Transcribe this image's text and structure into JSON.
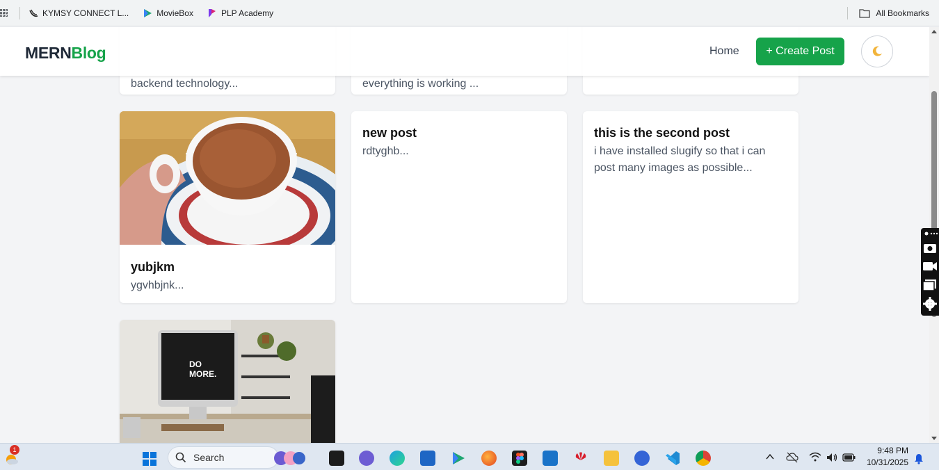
{
  "bookmarks": {
    "items": [
      {
        "label": "KYMSY CONNECT L...",
        "icon": "kymsy-icon"
      },
      {
        "label": "MovieBox",
        "icon": "moviebox-icon"
      },
      {
        "label": "PLP Academy",
        "icon": "plp-icon"
      }
    ],
    "all_label": "All Bookmarks"
  },
  "navbar": {
    "logo_part1": "MERN",
    "logo_part2": "Blog",
    "home_label": "Home",
    "create_label": "+ Create Post",
    "theme_icon": "moon-icon"
  },
  "top_row": [
    {
      "excerpt": "backend technology..."
    },
    {
      "excerpt": "everything is working ..."
    },
    {
      "excerpt": ""
    }
  ],
  "posts": [
    {
      "title": "yubjkm",
      "excerpt": "ygvhbjnk...",
      "image": "coffee-cup"
    },
    {
      "title": "new post",
      "excerpt": "rdtyghb..."
    },
    {
      "title": "this is the second post",
      "excerpt": "i have installed slugify so that i can post many images as possible..."
    }
  ],
  "bottom_post": {
    "image": "desk-computer",
    "screen_text": "DO MORE."
  },
  "taskbar": {
    "search_placeholder": "Search",
    "weather_badge": "1",
    "time": "9:48 PM",
    "date": "10/31/2025"
  },
  "colors": {
    "brand": "#16a34a",
    "logo_dark": "#1f2937"
  }
}
